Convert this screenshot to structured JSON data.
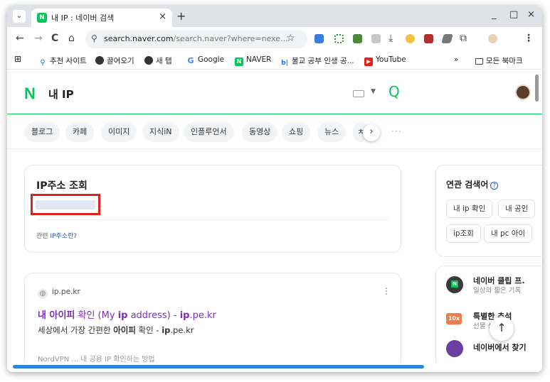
{
  "tab": {
    "title": "내 IP : 네이버 검색",
    "favicon_letter": "N",
    "close": "×",
    "new_tab": "+",
    "dropdown": "⌄"
  },
  "window_controls": {
    "minimize": "_",
    "maximize": "□",
    "close": "×"
  },
  "toolbar": {
    "back": "←",
    "forward": "→",
    "reload": "C",
    "home": "⌂",
    "url_domain": "search.naver.com",
    "url_rest": "/search.naver?where=nexe...",
    "star": "☆",
    "menu": "⋮"
  },
  "bookmarks": {
    "apps": "⊞",
    "items": [
      {
        "label": "추천 사이트",
        "icon": "search-icon"
      },
      {
        "label": "끌어오기",
        "icon": "globe-icon"
      },
      {
        "label": "새 탭",
        "icon": "globe-icon"
      },
      {
        "label": "Google",
        "icon": "google-icon"
      },
      {
        "label": "NAVER",
        "icon": "naver-icon"
      },
      {
        "label": "불교 공부 인생 공...",
        "icon": "bl-icon"
      },
      {
        "label": "YouTube",
        "icon": "youtube-icon"
      }
    ],
    "overflow": "»",
    "all_bookmarks": "모든 북마크"
  },
  "naver": {
    "logo": "N",
    "query": "내 IP",
    "search_icon": "Q",
    "tabs": [
      "블로그",
      "카페",
      "이미지",
      "지식iN",
      "인플루언서",
      "동영상",
      "쇼핑",
      "뉴스",
      "ㅊ"
    ],
    "next": "›",
    "more": "···"
  },
  "ip_card": {
    "title": "IP주소 조회",
    "related_prefix": "관련 ",
    "related_link": "IP주소란?"
  },
  "result": {
    "site": "ip.pe.kr",
    "kebab": "⋮",
    "title_parts": [
      "내 아이피",
      " 확인 (My ",
      "ip",
      " address) - ",
      "ip",
      ".pe.kr"
    ],
    "desc_parts": [
      "세상에서 가장 간편한 ",
      "아이피",
      " 확인 - ",
      "ip",
      ".pe.kr"
    ],
    "next_cut": "NordVPN ... 내 공용 IP 확인하는 방법"
  },
  "related": {
    "title": "연관 검색어",
    "help": "?",
    "chips_row1": [
      "내 ip 확인",
      "내 공인"
    ],
    "chips_row2": [
      "ip조회",
      "내 pc 아이"
    ]
  },
  "side": {
    "club_title": "네이버 클립 프.",
    "club_sub": "일상의 짧은 기록",
    "badge_10x": "10x",
    "special_title": "특별한 추석",
    "special_sub": "선물 선물",
    "more_title": "네이버에서 찾기"
  },
  "top_button": "↑",
  "colors": {
    "naver_green": "#03c75a",
    "highlight_red": "#e0201c",
    "visited_purple": "#7a2fb8",
    "scroll_blue": "#2e86d6"
  }
}
